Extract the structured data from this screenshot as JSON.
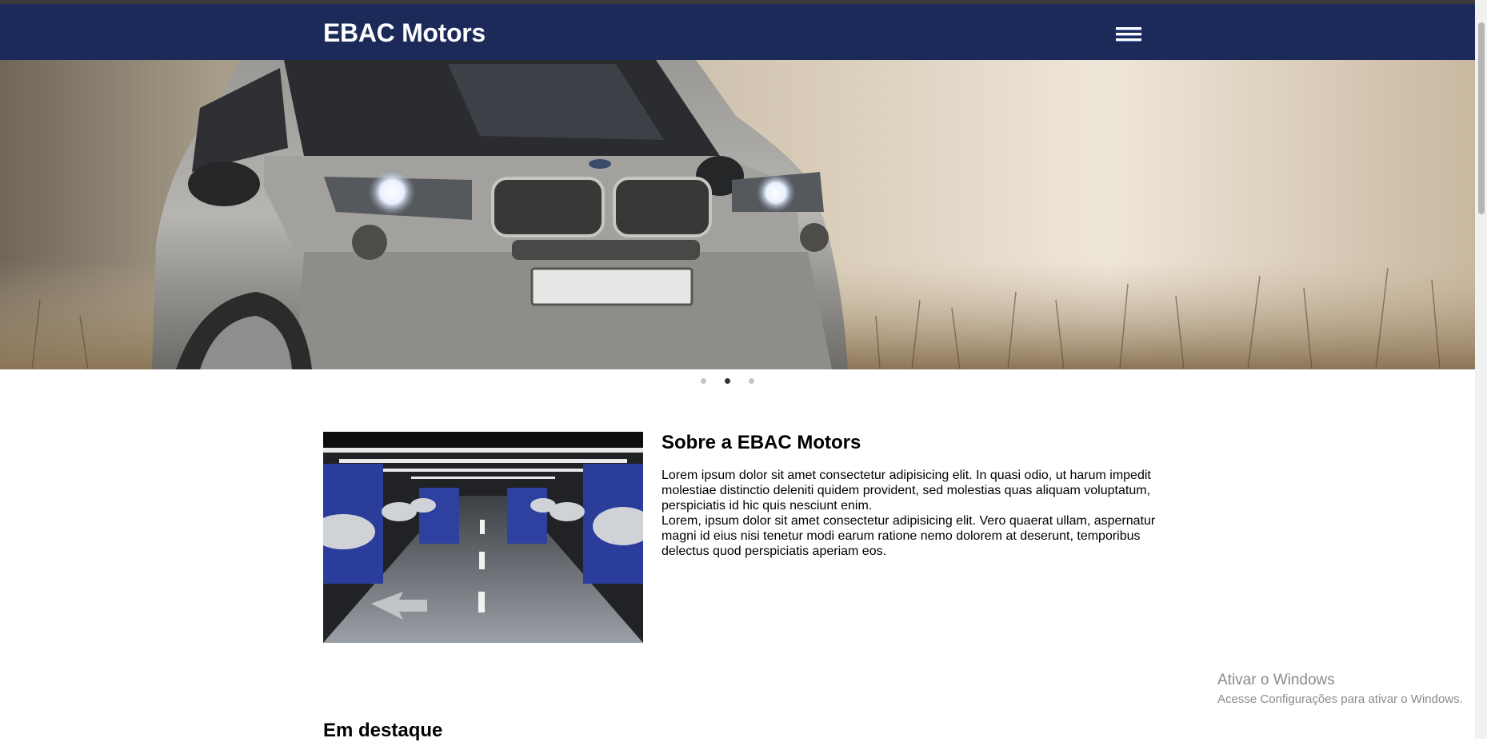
{
  "header": {
    "brand": "EBAC Motors",
    "menu_icon": "hamburger-menu-icon",
    "background_color": "#1b2a59"
  },
  "carousel": {
    "slide_count": 3,
    "active_index": 1,
    "image": "silver suv car on field"
  },
  "about": {
    "title": "Sobre a EBAC Motors",
    "image": "parking garage with cars",
    "paragraphs": [
      "Lorem ipsum dolor sit amet consectetur adipisicing elit. In quasi odio, ut harum impedit molestiae distinctio deleniti quidem provident, sed molestias quas aliquam voluptatum, perspiciatis id hic quis nesciunt enim.",
      "Lorem, ipsum dolor sit amet consectetur adipisicing elit. Vero quaerat ullam, aspernatur magni id eius nisi tenetur modi earum ratione nemo dolorem at deserunt, temporibus delectus quod perspiciatis aperiam eos."
    ]
  },
  "featured": {
    "title": "Em destaque"
  },
  "watermark": {
    "line1": "Ativar o Windows",
    "line2": "Acesse Configurações para ativar o Windows."
  }
}
